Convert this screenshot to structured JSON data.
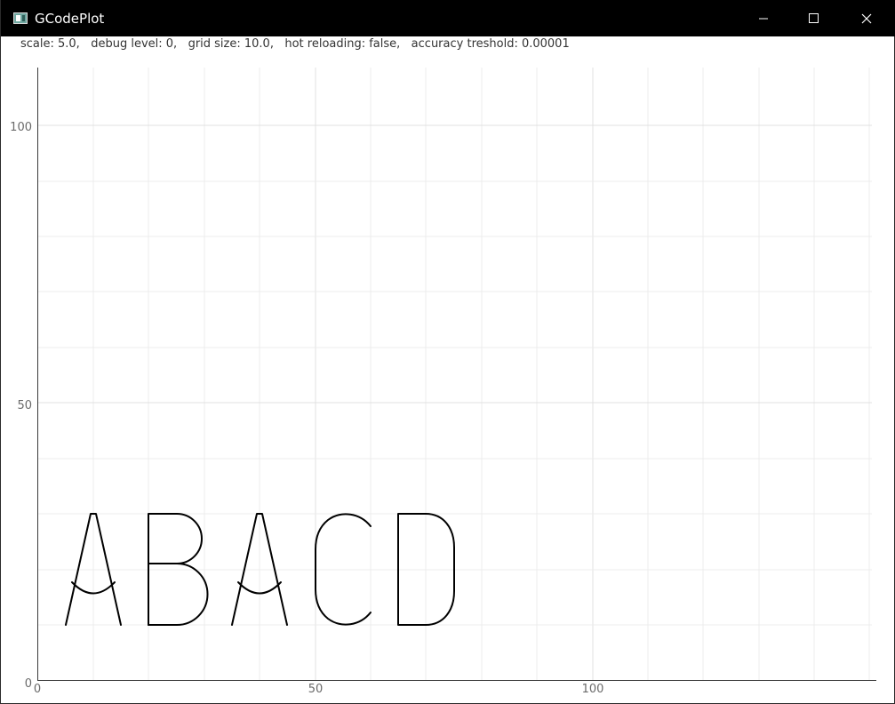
{
  "window": {
    "title": "GCodePlot",
    "controls": {
      "minimize_icon": "minimize-icon",
      "maximize_icon": "maximize-icon",
      "close_icon": "close-icon"
    }
  },
  "status": {
    "text": "scale: 5.0,   debug level: 0,   grid size: 10.0,   hot reloading: false,   accuracy treshold: 0.00001",
    "scale": "5.0",
    "debug_level": "0",
    "grid_size": "10.0",
    "hot_reloading": "false",
    "accuracy_threshold": "0.00001"
  },
  "plot": {
    "x_ticks": [
      "0",
      "50",
      "100"
    ],
    "y_ticks": [
      "0",
      "50",
      "100"
    ],
    "plotted_text": "ABACD",
    "grid_color": "#e8e8e8",
    "axis_color": "#3a3a3a",
    "stroke_color": "#000000"
  }
}
